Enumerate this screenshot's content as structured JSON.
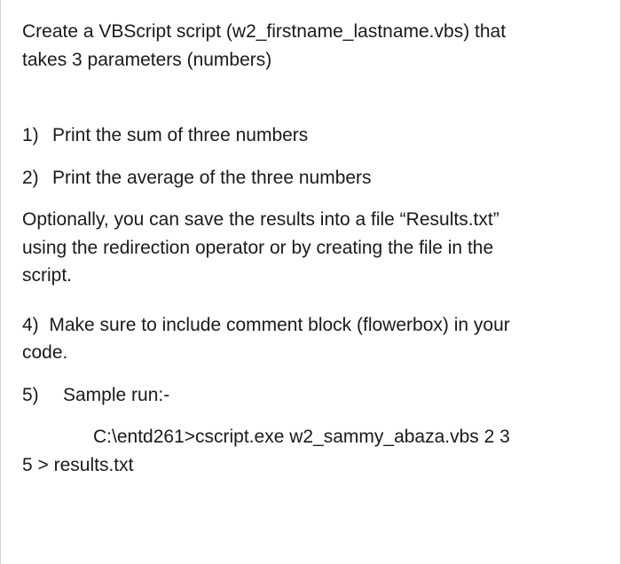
{
  "intro": {
    "p1_a": "Create a VBScript script (w2_firstname_lastname.vbs) that",
    "p1_b": "takes 3 parameters (numbers)"
  },
  "items": {
    "i1": {
      "marker": "1)",
      "text": "Print the sum of three numbers"
    },
    "i2": {
      "marker": "2)",
      "text": "Print the average of the three numbers"
    }
  },
  "optional": {
    "l1": "Optionally, you can save the results into a file “Results.txt”",
    "l2": "using the redirection operator or by creating the file in the",
    "l3": "script."
  },
  "item4": {
    "marker": "4)",
    "l1": "Make sure to include comment block (flowerbox) in your",
    "l2": "code."
  },
  "item5": {
    "marker": "5)",
    "label": "Sample run:-",
    "cmd": "C:\\entd261>cscript.exe w2_sammy_abaza.vbs  2 3",
    "tail": "5  > results.txt"
  }
}
